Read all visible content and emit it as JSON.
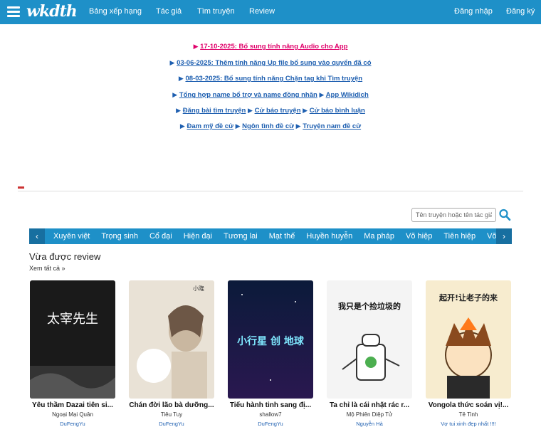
{
  "header": {
    "logo": "wkdth",
    "nav": [
      "Bảng xếp hạng",
      "Tác giả",
      "Tìm truyện",
      "Review"
    ],
    "login": "Đăng nhập",
    "register": "Đăng ký"
  },
  "announcements": {
    "line1": "17-10-2025: Bổ sung tính năng Audio cho App",
    "line2": "03-06-2025: Thêm tính năng Up file bổ sung vào quyển đã có",
    "line3": "08-03-2025: Bổ sung tính năng Chặn tag khi Tìm truyện",
    "line4a": "Tổng hợp name bổ trợ và name đồng nhân",
    "line4b": "App Wikidich",
    "line5a": "Đăng bài tìm truyện",
    "line5b": "Cử báo truyện",
    "line5c": "Cử báo bình luận",
    "line6a": "Đam mỹ đề cử",
    "line6b": "Ngôn tình đề cử",
    "line6c": "Truyện nam đề cử"
  },
  "search": {
    "placeholder": "Tên truyện hoặc tên tác giả"
  },
  "genres": [
    "Xuyên việt",
    "Trọng sinh",
    "Cổ đại",
    "Hiện đại",
    "Tương lai",
    "Mạt thế",
    "Huyền huyễn",
    "Ma pháp",
    "Võ hiệp",
    "Tiên hiệp",
    "Võng"
  ],
  "review_section": {
    "title": "Vừa được review",
    "see_all": "Xem tất cả »"
  },
  "books": [
    {
      "title": "Yêu thầm Dazai tiên si...",
      "author": "Ngoại Mại Quân",
      "user": "DuFengYu",
      "cover_text": "太宰先生"
    },
    {
      "title": "Chán đời lão bà dưỡng...",
      "author": "Tiêu Tuy",
      "user": "DuFengYu",
      "cover_text": "小隆"
    },
    {
      "title": "Tiểu hành tinh sang đị...",
      "author": "shallow7",
      "user": "DuFengYu",
      "cover_text": "小行星 创 地球"
    },
    {
      "title": "Ta chỉ là cái nhặt rác r...",
      "author": "Mộ Phiên Diệp Tử",
      "user": "Nguyễn Hà",
      "cover_text": "我只是个捡垃圾的"
    },
    {
      "title": "Vongola thức soán vị!...",
      "author": "Tê Tinh",
      "user": "Vợ tui xinh đẹp nhất !!!!",
      "cover_text": "起开!让老子的来"
    }
  ],
  "colors": {
    "brand": "#1e90c8",
    "link": "#1e5fb0",
    "highlight": "#e0006a"
  }
}
